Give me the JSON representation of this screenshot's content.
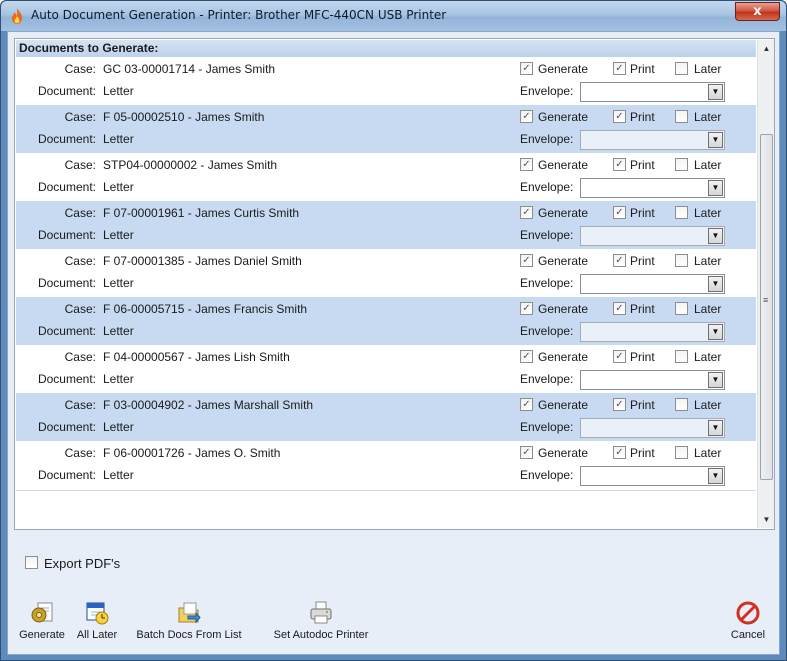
{
  "window": {
    "title": "Auto Document Generation - Printer: Brother MFC-440CN USB Printer",
    "close_glyph": "x"
  },
  "list": {
    "header": "Documents to Generate:",
    "case_label": "Case:",
    "document_label": "Document:",
    "envelope_label": "Envelope:",
    "generate_label": "Generate",
    "print_label": "Print",
    "later_label": "Later",
    "rows": [
      {
        "case": "GC 03-00001714 - James  Smith",
        "document": "Letter",
        "generate": true,
        "print": true,
        "later": false,
        "envelope": ""
      },
      {
        "case": "F  05-00002510 - James  Smith",
        "document": "Letter",
        "generate": true,
        "print": true,
        "later": false,
        "envelope": ""
      },
      {
        "case": "STP04-00000002 - James  Smith",
        "document": "Letter",
        "generate": true,
        "print": true,
        "later": false,
        "envelope": ""
      },
      {
        "case": "F  07-00001961 - James Curtis Smith",
        "document": "Letter",
        "generate": true,
        "print": true,
        "later": false,
        "envelope": ""
      },
      {
        "case": "F  07-00001385 - James Daniel Smith",
        "document": "Letter",
        "generate": true,
        "print": true,
        "later": false,
        "envelope": ""
      },
      {
        "case": "F  06-00005715 - James Francis Smith",
        "document": "Letter",
        "generate": true,
        "print": true,
        "later": false,
        "envelope": ""
      },
      {
        "case": "F  04-00000567 - James Lish Smith",
        "document": "Letter",
        "generate": true,
        "print": true,
        "later": false,
        "envelope": ""
      },
      {
        "case": "F  03-00004902 - James Marshall Smith",
        "document": "Letter",
        "generate": true,
        "print": true,
        "later": false,
        "envelope": ""
      },
      {
        "case": "F  06-00001726 - James O. Smith",
        "document": "Letter",
        "generate": true,
        "print": true,
        "later": false,
        "envelope": ""
      }
    ]
  },
  "export": {
    "label": "Export PDF's",
    "checked": false
  },
  "toolbar": {
    "generate": {
      "label": "Generate",
      "icon": "gear-document-icon"
    },
    "all_later": {
      "label": "All Later",
      "icon": "calendar-clock-icon"
    },
    "batch": {
      "label": "Batch Docs From List",
      "icon": "folder-arrow-icon"
    },
    "set_printer": {
      "label": "Set Autodoc Printer",
      "icon": "printer-icon"
    },
    "cancel": {
      "label": "Cancel",
      "icon": "cancel-icon"
    }
  },
  "colors": {
    "row_alt": "#c8daf2",
    "header_bg": "#bcd2ea",
    "window_frame": "#5d8bbe",
    "cancel_red": "#d0301c"
  }
}
